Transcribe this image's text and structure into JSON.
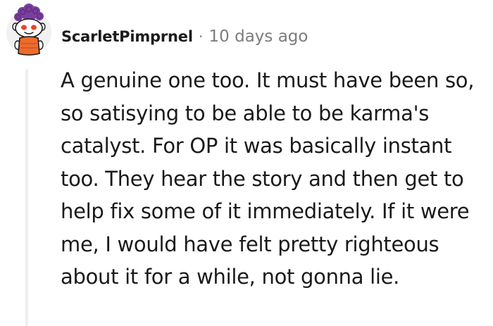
{
  "comment": {
    "author": "ScarletPimprnel",
    "separator": "·",
    "timestamp": "10 days ago",
    "body": "A genuine one too. It must have been so, so satisying to be able to be karma's catalyst. For OP it was basically instant too. They hear the story and then get to help fix some of it immediately. If it were me, I would have felt pretty righteous about it for a while, not gonna lie."
  },
  "avatar": {
    "icon": "snoo-avatar-icon",
    "hair_color": "#7b3f9e",
    "eye_color": "#e8442e",
    "shirt_color": "#ee6b2c",
    "body_color": "#ffffff"
  },
  "colors": {
    "author": "#1c1c1c",
    "meta": "#7c7c7c",
    "text": "#1a1a1b",
    "thread_line": "#edeff1"
  }
}
